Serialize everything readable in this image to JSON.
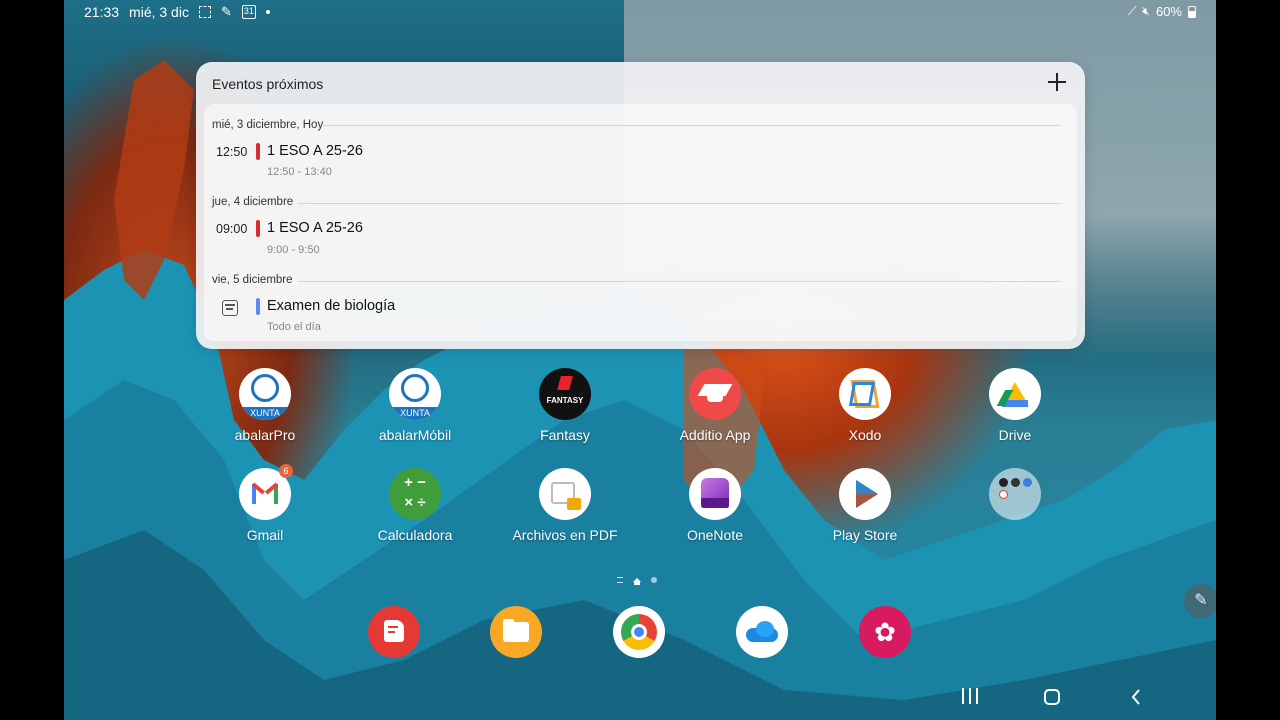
{
  "status_bar": {
    "time": "21:33",
    "date": "mié, 3 dic",
    "calendar_badge": "31",
    "battery": "60%",
    "icons_left": [
      "screenshot-icon",
      "pen-icon",
      "calendar-icon",
      "dot-icon"
    ],
    "icons_right": [
      "wifi-off-icon",
      "mute-icon",
      "battery-icon"
    ]
  },
  "widget": {
    "title": "Eventos próximos",
    "add_icon": "plus-icon",
    "days": [
      {
        "label": "mié, 3 diciembre, Hoy",
        "events": [
          {
            "time": "12:50",
            "title": "1 ESO A 25-26",
            "range": "12:50 - 13:40",
            "color": "#d32f2f"
          }
        ]
      },
      {
        "label": "jue, 4 diciembre",
        "events": [
          {
            "time": "09:00",
            "title": "1 ESO A 25-26",
            "range": "9:00 - 9:50",
            "color": "#d32f2f"
          }
        ]
      },
      {
        "label": "vie, 5 diciembre",
        "events": [
          {
            "time": "",
            "title": "Examen de biología",
            "range": "Todo el día",
            "color": "#5b8def",
            "icon": "calendar-icon"
          }
        ]
      }
    ]
  },
  "apps": {
    "row1": [
      {
        "label": "abalarPro",
        "icon": "xunta-icon",
        "sub": "XUNTA"
      },
      {
        "label": "abalarMóbil",
        "icon": "xunta-icon",
        "sub": "XUNTA"
      },
      {
        "label": "Fantasy",
        "icon": "fantasy-icon",
        "sub": "FANTASY"
      },
      {
        "label": "Additio App",
        "icon": "graduation-cap-icon"
      },
      {
        "label": "Xodo",
        "icon": "xodo-icon"
      },
      {
        "label": "Drive",
        "icon": "drive-icon"
      }
    ],
    "row2": [
      {
        "label": "Gmail",
        "icon": "gmail-icon",
        "badge": "6"
      },
      {
        "label": "Calculadora",
        "icon": "calculator-icon"
      },
      {
        "label": "Archivos en PDF",
        "icon": "pdf-files-icon"
      },
      {
        "label": "OneNote",
        "icon": "onenote-icon"
      },
      {
        "label": "Play Store",
        "icon": "play-store-icon"
      },
      {
        "label": "",
        "icon": "folder-icon"
      }
    ]
  },
  "dock": [
    {
      "icon": "notes-icon",
      "color": "#e53935"
    },
    {
      "icon": "files-icon",
      "color": "#f9a825"
    },
    {
      "icon": "chrome-icon",
      "color": "#ffffff"
    },
    {
      "icon": "onedrive-icon",
      "color": "#ffffff"
    },
    {
      "icon": "flower-icon",
      "color": "#d81b60"
    }
  ],
  "colors": {
    "widget_bg": "#f0f0f2",
    "event_red": "#d32f2f",
    "event_blue": "#5b8def",
    "badge": "#e8643c"
  }
}
